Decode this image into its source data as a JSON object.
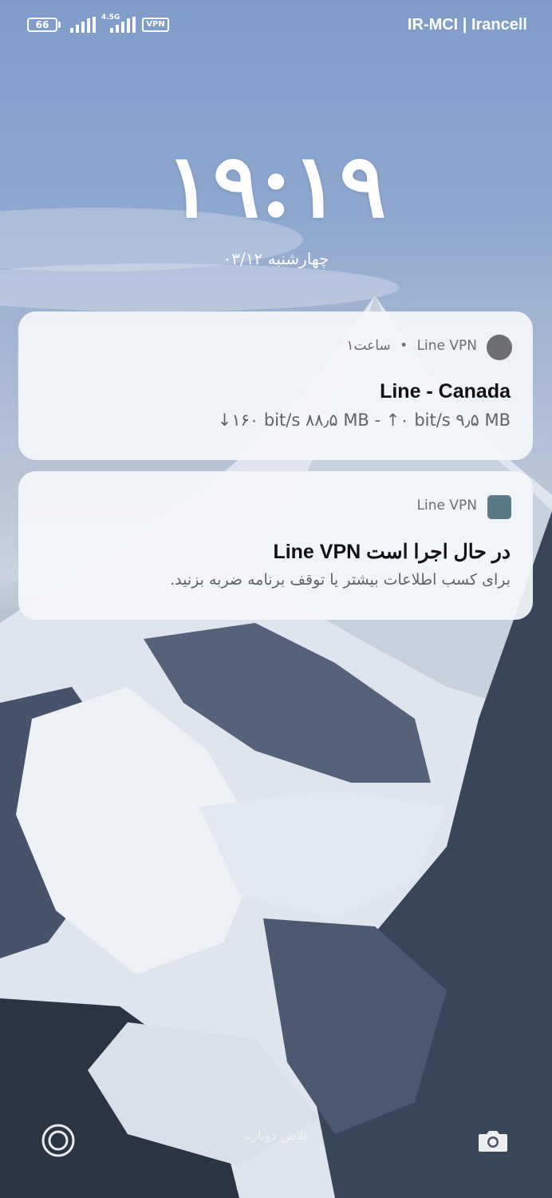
{
  "status_bar": {
    "battery": "66",
    "network_type": "4.5G",
    "vpn_badge": "VPN",
    "carrier": "IR-MCI | Irancell"
  },
  "lockscreen": {
    "time": "۱۹:۱۹",
    "date": "چهارشنبه ۰۳/۱۲"
  },
  "notifications": [
    {
      "app_name": "Line VPN",
      "time_ago": "۱ساعت",
      "separator": "•",
      "title": "Line - Canada",
      "text": "↓۱۶۰ bit/s ۸۸٫۵ MB - ↑۰ bit/s ۹٫۵ MB",
      "icon": "app-circle-icon"
    },
    {
      "app_name": "Line VPN",
      "title": "در حال اجرا است Line VPN",
      "text": "برای کسب اطلاعات بیشتر یا توقف برنامه ضربه بزنید.",
      "icon": "app-square-icon"
    }
  ],
  "bottom": {
    "retry_hint": "تلاش دوباره",
    "left_icon": "record-icon",
    "right_icon": "camera-icon"
  },
  "colors": {
    "card_bg": "#f4f6fa",
    "title_text": "#111111",
    "secondary_text": "#6a6d73"
  }
}
